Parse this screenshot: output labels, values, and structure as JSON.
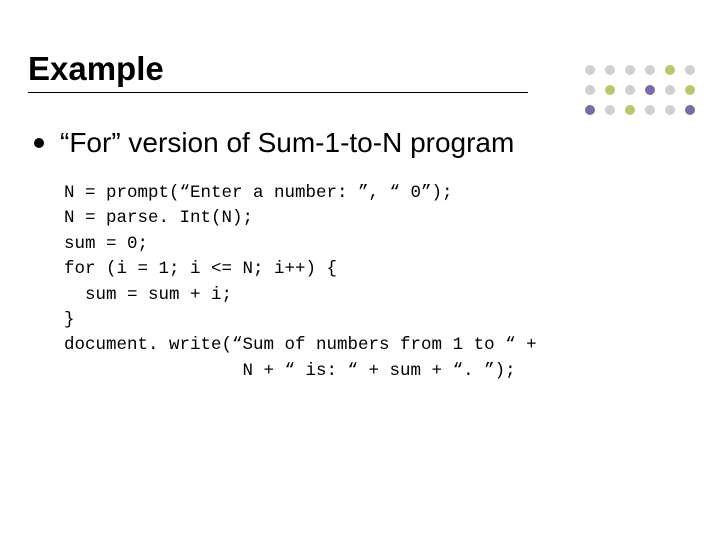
{
  "title": "Example",
  "bullet": "“For” version of Sum-1-to-N program",
  "code": {
    "l1": "N = prompt(“Enter a number: ”, “ 0”);",
    "l2": "N = parse. Int(N);",
    "l3": "sum = 0;",
    "l4": "for (i = 1; i <= N; i++) {",
    "l5": "  sum = sum + i;",
    "l6": "}",
    "l7": "document. write(“Sum of numbers from 1 to “ +",
    "l8": "                 N + “ is: “ + sum + “. ”);"
  },
  "decor_colors": {
    "gray": "#cfcfcf",
    "green": "#b7c96a",
    "purple": "#7d6aa8"
  }
}
